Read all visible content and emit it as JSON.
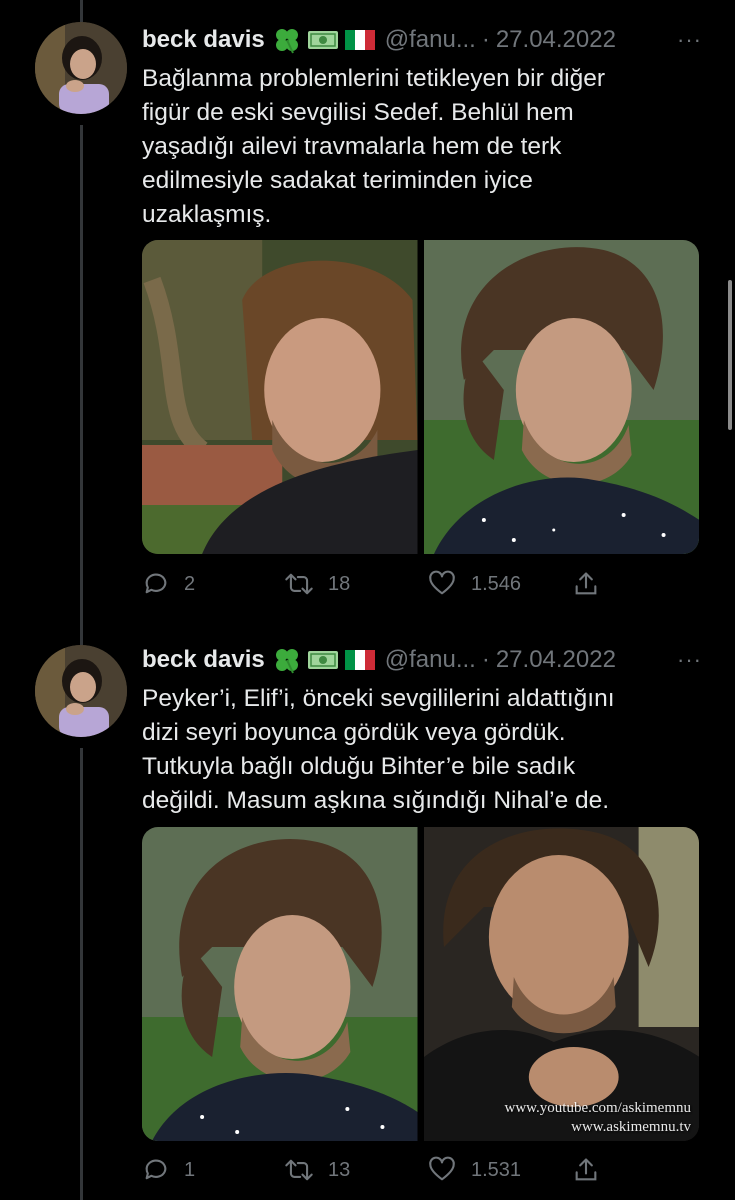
{
  "colors": {
    "background": "#000000",
    "text_primary": "#e7e9ea",
    "text_secondary": "#71767b",
    "thread_line": "#333639"
  },
  "tweets": [
    {
      "name": "beck davis",
      "emojis": [
        "four-leaf-clover",
        "dollar-banknote",
        "italy-flag"
      ],
      "handle": "@fanu...",
      "dot": "·",
      "date": "27.04.2022",
      "more": "···",
      "text_lines": [
        "Bağlanma problemlerini tetikleyen bir diğer",
        "figür de eski sevgilisi Sedef. Behlül hem",
        "yaşadığı ailevi travmalarla hem de terk",
        "edilmesiyle sadakat teriminden iyice",
        "uzaklaşmış."
      ],
      "images": [
        "man-portrait-garden",
        "man-portrait-starry-shirt"
      ],
      "replies": "2",
      "retweets": "18",
      "likes": "1.546"
    },
    {
      "name": "beck davis",
      "emojis": [
        "four-leaf-clover",
        "dollar-banknote",
        "italy-flag"
      ],
      "handle": "@fanu...",
      "dot": "·",
      "date": "27.04.2022",
      "more": "···",
      "text_lines": [
        "Peyker’i, Elif’i, önceki sevgililerini aldattığını",
        "dizi seyri boyunca gördük veya gördük.",
        "Tutkuyla bağlı olduğu Bihter’e bile sadık",
        "değildi. Masum aşkına sığındığı Nihal’e de."
      ],
      "images": [
        "man-portrait-starry-shirt",
        "man-portrait-smiling"
      ],
      "watermark": [
        "www.youtube.com/askimemnu",
        "www.askimemnu.tv"
      ],
      "replies": "1",
      "retweets": "13",
      "likes": "1.531"
    }
  ]
}
